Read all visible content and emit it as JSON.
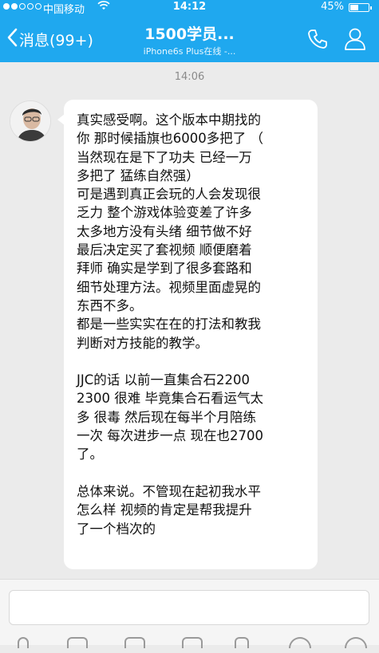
{
  "status_bar": {
    "carrier": "中国移动",
    "time": "14:12",
    "battery": "45%",
    "battery_level": 0.45
  },
  "nav": {
    "back_label": "消息(99+)",
    "title": "1500学员...",
    "subtitle": "iPhone6s Plus在线 -..."
  },
  "chat": {
    "timestamp": "14:06",
    "message_lines": [
      "真实感受啊。这个版本中期找的",
      "你 那时候插旗也6000多把了 （",
      "当然现在是下了功夫 已经一万",
      "多把了 猛练自然强）",
      "可是遇到真正会玩的人会发现很",
      "乏力 整个游戏体验变差了许多",
      "太多地方没有头绪 细节做不好",
      "最后决定买了套视频 顺便磨着",
      "拜师 确实是学到了很多套路和",
      "细节处理方法。视频里面虚晃的",
      "东西不多。",
      "都是一些实实在在的打法和教我",
      "判断对方技能的教学。",
      "",
      "JJC的话 以前一直集合石2200",
      "2300 很难 毕竟集合石看运气太",
      "多 很毒 然后现在每半个月陪练",
      "一次 每次进步一点 现在也2700",
      "了。",
      "",
      "总体来说。不管现在起初我水平",
      "怎么样 视频的肯定是帮我提升",
      "了一个档次的"
    ]
  },
  "icons": {
    "back": "chevron-left-icon",
    "call": "phone-icon",
    "profile": "person-icon",
    "wifi": "wifi-icon"
  },
  "colors": {
    "accent": "#1fa8ef",
    "background": "#ebebeb",
    "bubble": "#ffffff"
  }
}
